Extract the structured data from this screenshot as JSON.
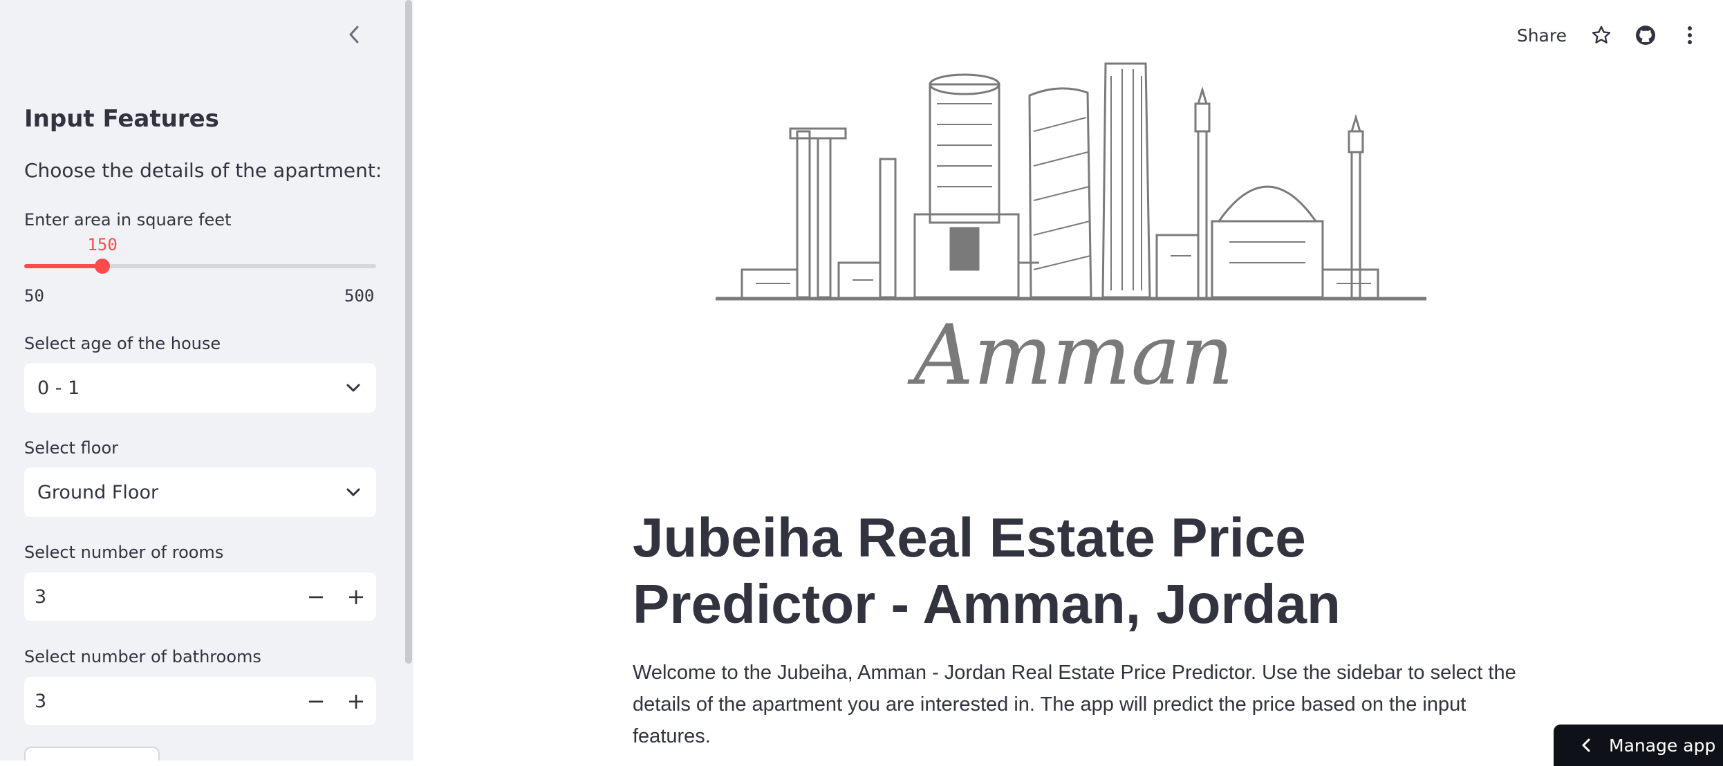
{
  "sidebar": {
    "title": "Input Features",
    "subtitle": "Choose the details of the apartment:",
    "area": {
      "label": "Enter area in square feet",
      "value": "150",
      "min": "50",
      "max": "500",
      "fraction": 0.2222
    },
    "age": {
      "label": "Select age of the house",
      "value": "0 - 1"
    },
    "floor": {
      "label": "Select floor",
      "value": "Ground Floor"
    },
    "rooms": {
      "label": "Select number of rooms",
      "value": "3",
      "decrement": "−",
      "increment": "+"
    },
    "bathrooms": {
      "label": "Select number of bathrooms",
      "value": "3",
      "decrement": "−",
      "increment": "+"
    }
  },
  "toolbar": {
    "share_label": "Share"
  },
  "main": {
    "hero_text": "Amman",
    "headline": "Jubeiha Real Estate Price Predictor - Amman, Jordan",
    "intro": "Welcome to the Jubeiha, Amman - Jordan Real Estate Price Predictor. Use the sidebar to select the details of the apartment you are interested in. The app will predict the price based on the input features."
  },
  "manage_app": {
    "label": "Manage app"
  },
  "colors": {
    "accent": "#ff4b4b",
    "sidebar_bg": "#f0f2f6",
    "text": "#31333f",
    "sketch": "#7a7a7a"
  },
  "icons": [
    "chevron-left-icon",
    "chevron-down-icon",
    "star-icon",
    "github-icon",
    "more-vertical-icon"
  ]
}
